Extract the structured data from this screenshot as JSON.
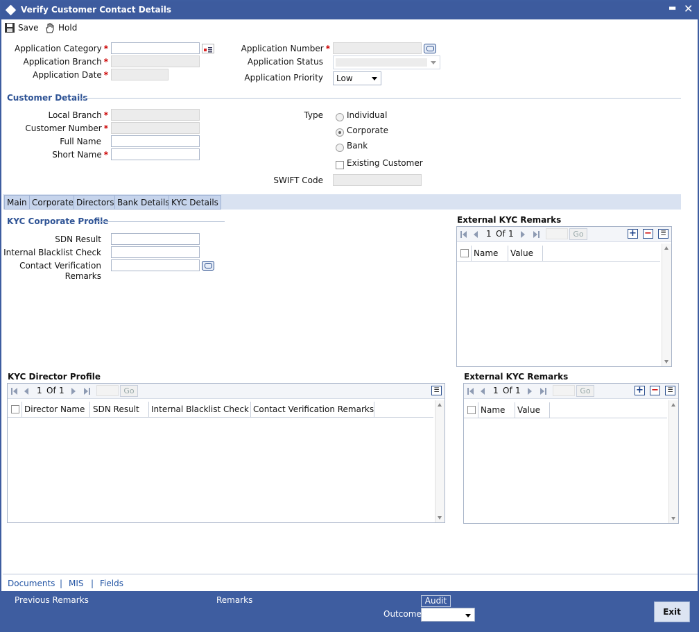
{
  "window": {
    "title": "Verify Customer Contact Details",
    "minimize": "▬",
    "close": "✕"
  },
  "toolbar": {
    "save": "Save",
    "hold": "Hold"
  },
  "header": {
    "app_category": "Application Category",
    "app_branch": "Application Branch",
    "app_date": "Application Date",
    "app_number": "Application Number",
    "app_status": "Application Status",
    "app_priority": "Application Priority",
    "app_priority_value": "Low",
    "req": "*"
  },
  "customer": {
    "section": "Customer Details",
    "local_branch": "Local Branch",
    "customer_number": "Customer Number",
    "full_name": "Full Name",
    "short_name": "Short Name",
    "type": "Type",
    "individual": "Individual",
    "corporate": "Corporate",
    "bank": "Bank",
    "existing_customer": "Existing Customer",
    "swift_code": "SWIFT Code"
  },
  "tabs": [
    "Main",
    "Corporate",
    "Directors",
    "Bank Details",
    "KYC Details"
  ],
  "kyc_corporate": {
    "section": "KYC Corporate Profile",
    "sdn_result": "SDN Result",
    "blacklist": "Internal Blacklist Check",
    "contact_verification_1": "Contact Verification",
    "contact_verification_2": "Remarks"
  },
  "ext_kyc_1": {
    "title": "External KYC Remarks",
    "page": "1",
    "of": "Of",
    "total": "1",
    "go": "Go",
    "cols": [
      "Name",
      "Value"
    ]
  },
  "kyc_director": {
    "title": "KYC Director Profile",
    "page": "1",
    "of": "Of",
    "total": "1",
    "go": "Go",
    "cols": [
      "Director Name",
      "SDN Result",
      "Internal Blacklist Check",
      "Contact Verification Remarks"
    ]
  },
  "ext_kyc_2": {
    "title": "External KYC Remarks",
    "page": "1",
    "of": "Of",
    "total": "1",
    "go": "Go",
    "cols": [
      "Name",
      "Value"
    ]
  },
  "footer_links": {
    "documents": "Documents",
    "sep1": "|",
    "mis": "MIS",
    "sep2": "|",
    "fields": "Fields"
  },
  "footer": {
    "previous_remarks": "Previous Remarks",
    "remarks": "Remarks",
    "audit": "Audit",
    "outcome": "Outcome",
    "exit": "Exit"
  }
}
